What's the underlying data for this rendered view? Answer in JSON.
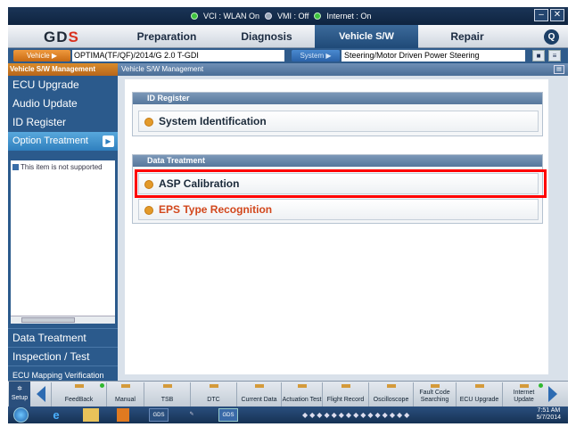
{
  "status": {
    "vci": "VCI : WLAN On",
    "vmi": "VMI : Off",
    "internet": "Internet : On",
    "min": "–",
    "close": "✕"
  },
  "nav": {
    "logo_left": "GD",
    "logo_accent": "S",
    "tabs": [
      "Preparation",
      "Diagnosis",
      "Vehicle S/W Management",
      "Repair"
    ],
    "active_tab": "Vehicle S/W Management",
    "help": "Q"
  },
  "vehicle": {
    "vehicle_label": "Vehicle ▶",
    "vehicle_value": "OPTIMA(TF/QF)/2014/G 2.0 T-GDI",
    "system_label": "System ▶",
    "system_value": "Steering/Motor Driven Power Steering"
  },
  "sidebar": {
    "header": "Vehicle S/W Management",
    "items": [
      "ECU Upgrade",
      "Audio Update",
      "ID Register",
      "Option Treatment"
    ],
    "active_item": "Option Treatment",
    "note": "This item is not supported",
    "bottom_items": [
      "Data Treatment",
      "Inspection / Test",
      "ECU Mapping Verification"
    ]
  },
  "main": {
    "header": "Vehicle S/W Management",
    "groups": [
      {
        "title": "ID Register",
        "rows": [
          "System Identification"
        ]
      },
      {
        "title": "Data Treatment",
        "rows": [
          "ASP Calibration",
          "EPS Type Recognition"
        ]
      }
    ],
    "highlighted_row": "ASP Calibration"
  },
  "toolbar": {
    "setup": "Setup",
    "buttons": [
      "FeedBack",
      "Manual",
      "TSB",
      "DTC",
      "Current Data",
      "Actuation Test",
      "Flight Record",
      "Oscilloscope",
      "Fault Code Searching",
      "ECU Upgrade",
      "Internet Update"
    ]
  },
  "taskbar": {
    "gds1": "GDS",
    "gds2": "GDS",
    "time": "7:51 AM",
    "date": "5/7/2014"
  },
  "colors": {
    "accent_orange": "#d98b2a",
    "highlight_red": "#ff0000",
    "eps_text": "#d2471c",
    "nav_blue": "#1d3f66"
  }
}
